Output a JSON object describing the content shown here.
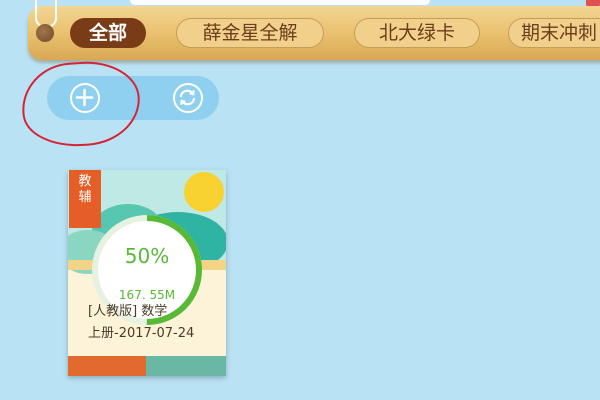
{
  "category_bar": {
    "tabs": [
      {
        "label": "全部",
        "active": true
      },
      {
        "label": "薛金星全解",
        "active": false
      },
      {
        "label": "北大绿卡",
        "active": false
      },
      {
        "label": "期末冲刺",
        "active": false
      }
    ]
  },
  "actions": {
    "add_icon": "plus-icon",
    "sync_icon": "refresh-icon"
  },
  "book": {
    "badge_text": "教辅",
    "progress_percent": 50,
    "progress_text": "50%",
    "size_text": "167. 55M",
    "title_line1": "[人教版] 数学",
    "title_line2": "上册-2017-07-24"
  },
  "colors": {
    "background": "#b9e3f4",
    "active_tab": "#7a3c17",
    "progress_green": "#57b936",
    "annotation_red": "#d62436",
    "badge_orange": "#e65e27"
  }
}
